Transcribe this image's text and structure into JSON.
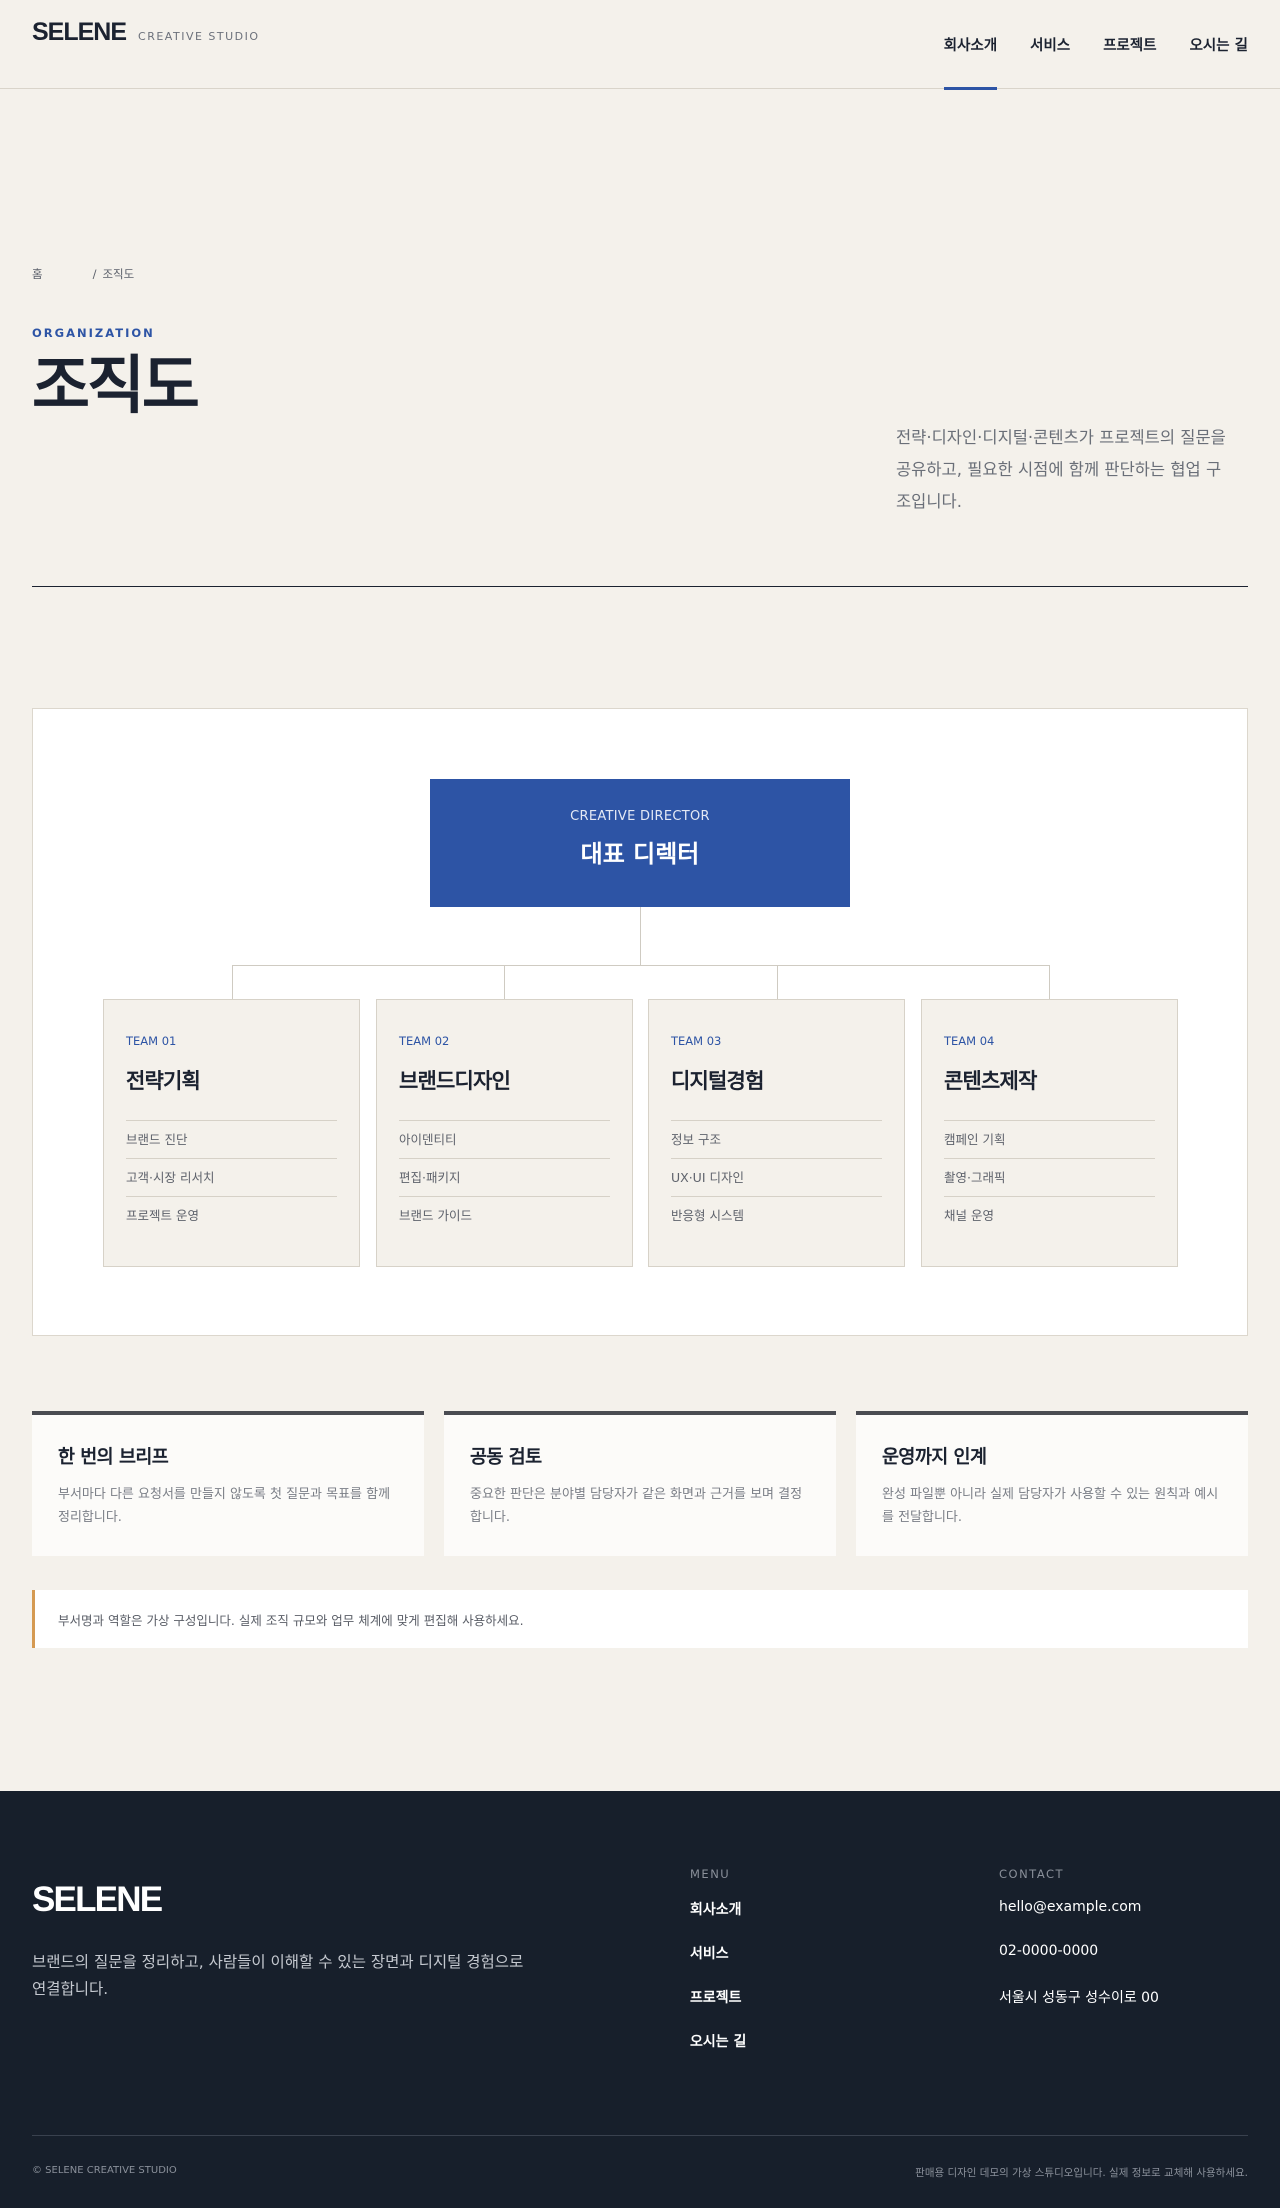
{
  "header": {
    "logo": "SELENE",
    "logo_sub": "CREATIVE STUDIO",
    "nav": [
      "회사소개",
      "서비스",
      "프로젝트",
      "오시는 길"
    ],
    "active_nav": 0
  },
  "hero": {
    "breadcrumb_home": "홈",
    "breadcrumb_sep": "/",
    "breadcrumb_current": "조직도",
    "eyebrow": "ORGANIZATION",
    "title": "조직도",
    "description": "전략·디자인·디지털·콘텐츠가 프로젝트의 질문을 공유하고, 필요한 시점에 함께 판단하는 협업 구조입니다."
  },
  "org": {
    "director": {
      "en": "CREATIVE DIRECTOR",
      "ko": "대표 디렉터"
    },
    "teams": [
      {
        "num": "TEAM 01",
        "name": "전략기획",
        "items": [
          "브랜드 진단",
          "고객·시장 리서치",
          "프로젝트 운영"
        ]
      },
      {
        "num": "TEAM 02",
        "name": "브랜드디자인",
        "items": [
          "아이덴티티",
          "편집·패키지",
          "브랜드 가이드"
        ]
      },
      {
        "num": "TEAM 03",
        "name": "디지털경험",
        "items": [
          "정보 구조",
          "UX·UI 디자인",
          "반응형 시스템"
        ]
      },
      {
        "num": "TEAM 04",
        "name": "콘텐츠제작",
        "items": [
          "캠페인 기획",
          "촬영·그래픽",
          "채널 운영"
        ]
      }
    ]
  },
  "features": [
    {
      "title": "한 번의 브리프",
      "desc": "부서마다 다른 요청서를 만들지 않도록 첫 질문과 목표를 함께 정리합니다."
    },
    {
      "title": "공동 검토",
      "desc": "중요한 판단은 분야별 담당자가 같은 화면과 근거를 보며 결정합니다."
    },
    {
      "title": "운영까지 인계",
      "desc": "완성 파일뿐 아니라 실제 담당자가 사용할 수 있는 원칙과 예시를 전달합니다."
    }
  ],
  "notice": "부서명과 역할은 가상 구성입니다. 실제 조직 규모와 업무 체계에 맞게 편집해 사용하세요.",
  "footer": {
    "logo": "SELENE",
    "desc": "브랜드의 질문을 정리하고, 사람들이 이해할 수 있는 장면과 디지털 경험으로 연결합니다.",
    "menu_head": "MENU",
    "menu": [
      "회사소개",
      "서비스",
      "프로젝트",
      "오시는 길"
    ],
    "contact_head": "CONTACT",
    "contact": [
      "hello@example.com",
      "02-0000-0000",
      "서울시 성동구 성수이로 00"
    ],
    "copyright": "© SELENE CREATIVE STUDIO",
    "note": "판매용 디자인 데모의 가상 스튜디오입니다. 실제 정보로 교체해 사용하세요."
  },
  "colors": {
    "accent": "#2d54a5",
    "background": "#f4f1eb",
    "footer": "#171f2b",
    "notice_bar": "#d59a52"
  }
}
